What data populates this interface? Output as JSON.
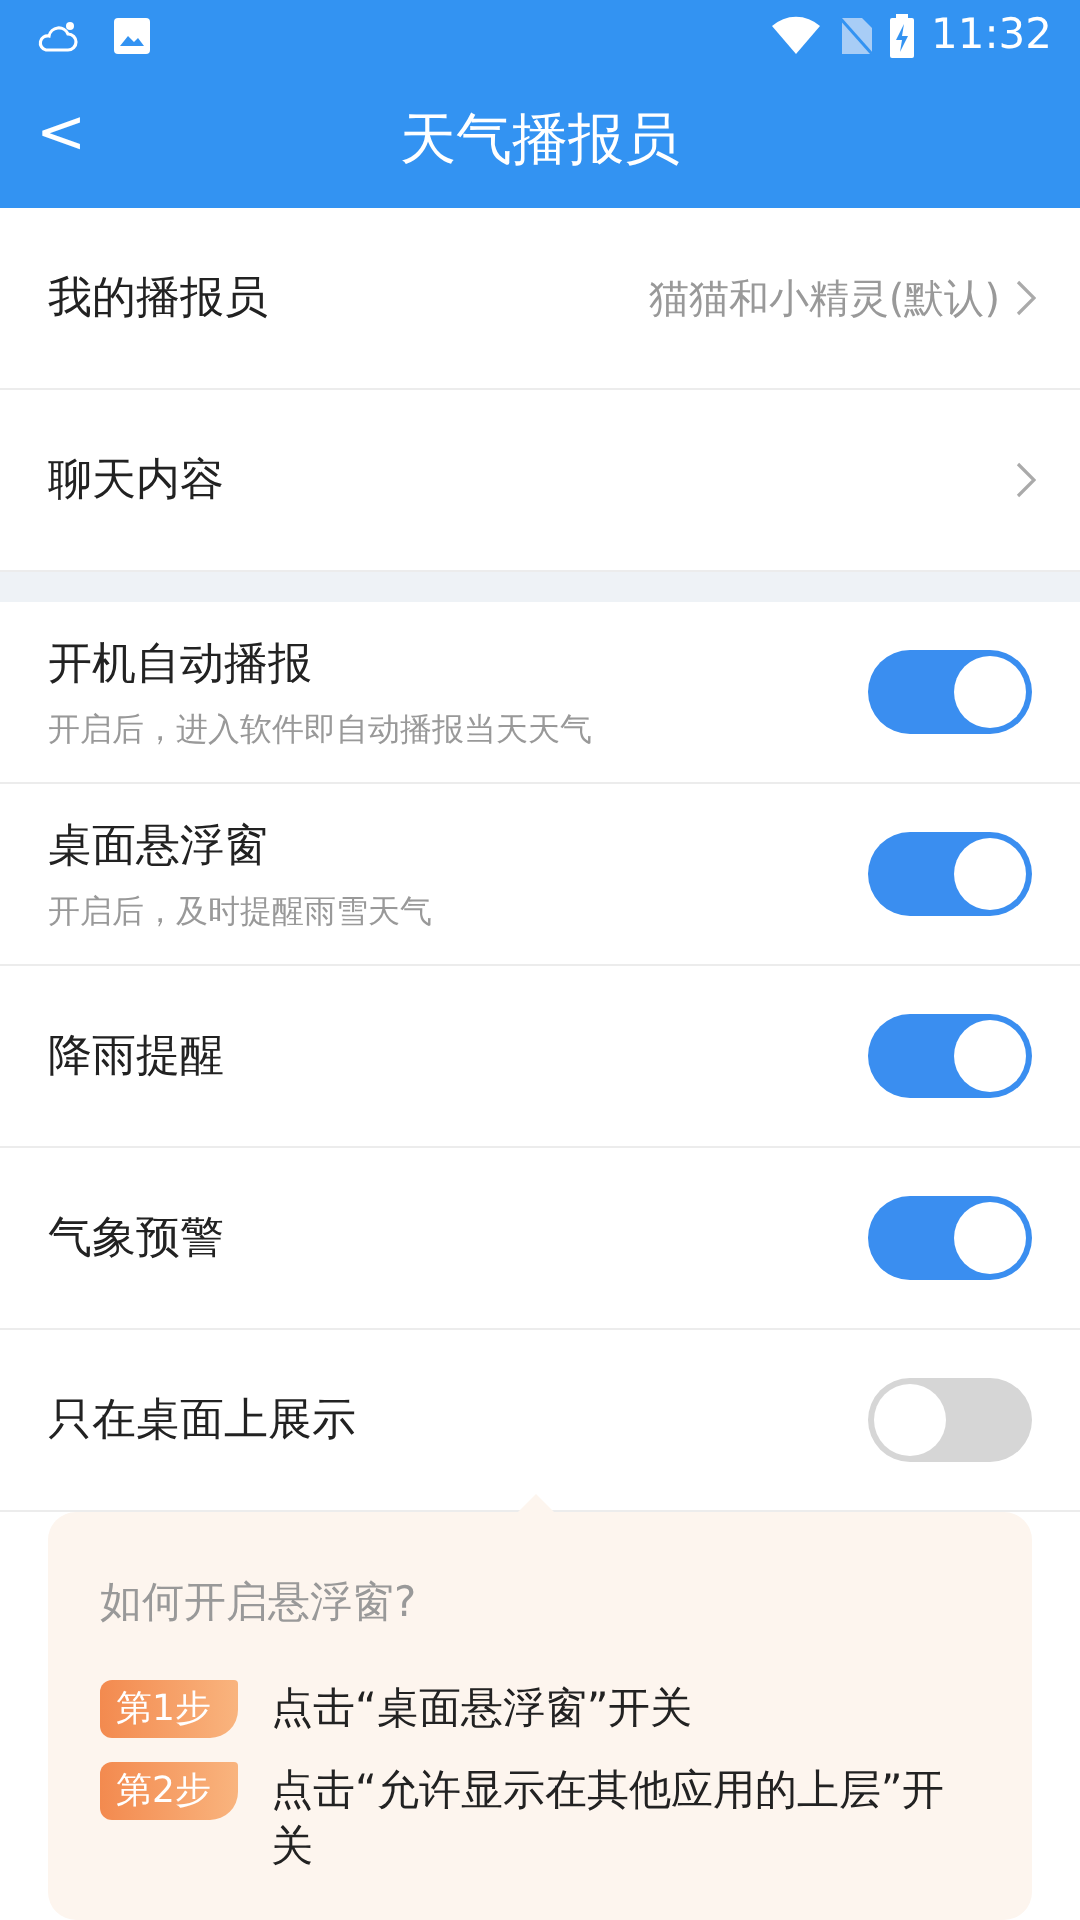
{
  "status_bar": {
    "time": "11:32"
  },
  "header": {
    "back": "<",
    "title": "天气播报员"
  },
  "nav_rows": [
    {
      "label": "我的播报员",
      "value": "猫猫和小精灵(默认)"
    },
    {
      "label": "聊天内容"
    }
  ],
  "toggles": [
    {
      "label": "开机自动播报",
      "hint": "开启后，进入软件即自动播报当天天气",
      "on": true
    },
    {
      "label": "桌面悬浮窗",
      "hint": "开启后，及时提醒雨雪天气",
      "on": true
    },
    {
      "label": "降雨提醒",
      "on": true
    },
    {
      "label": "气象预警",
      "on": true
    },
    {
      "label": "只在桌面上展示",
      "on": false
    }
  ],
  "guide": {
    "title": "如何开启悬浮窗?",
    "steps": [
      {
        "badge": "第1步",
        "text": "点击“桌面悬浮窗”开关"
      },
      {
        "badge": "第2步",
        "text": "点击“允许显示在其他应用的上层”开关"
      }
    ]
  }
}
